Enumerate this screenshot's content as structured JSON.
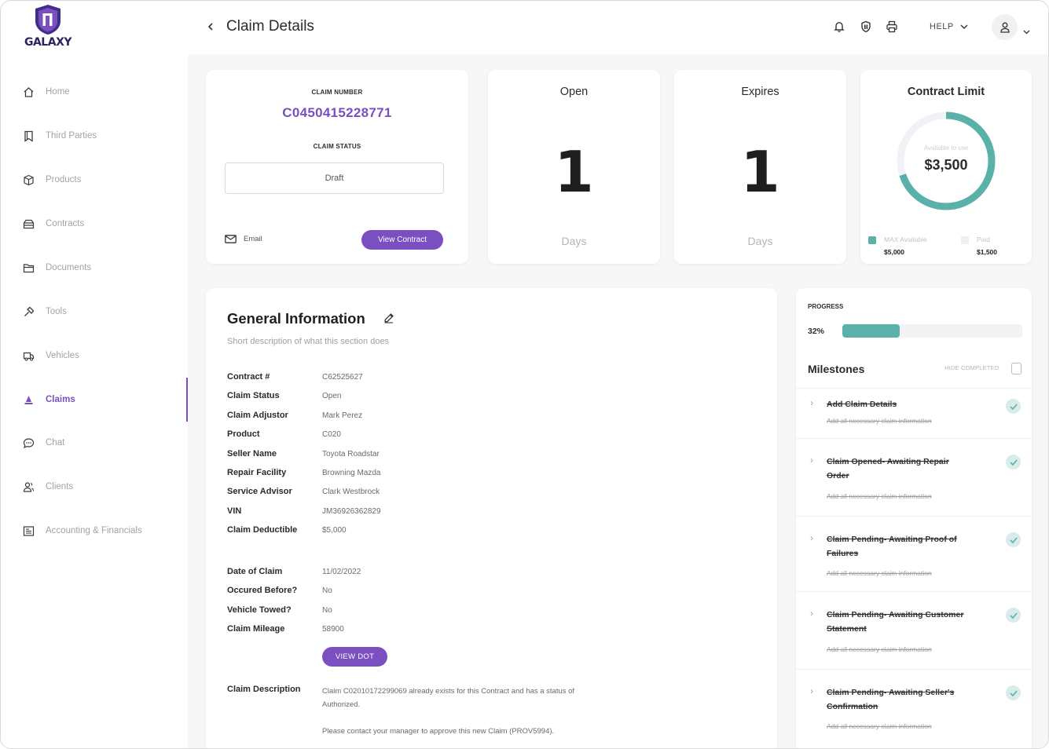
{
  "brand": {
    "name": "GALAXY",
    "accent": "#7a4fc0",
    "teal": "#5ab1a9"
  },
  "sidebar": {
    "items": [
      {
        "label": "Home",
        "icon": "home-icon"
      },
      {
        "label": "Third Parties",
        "icon": "bookmark-icon"
      },
      {
        "label": "Products",
        "icon": "box-icon"
      },
      {
        "label": "Contracts",
        "icon": "contract-icon"
      },
      {
        "label": "Documents",
        "icon": "folder-icon"
      },
      {
        "label": "Tools",
        "icon": "tools-icon"
      },
      {
        "label": "Vehicles",
        "icon": "truck-icon"
      },
      {
        "label": "Claims",
        "icon": "claims-icon",
        "active": true
      },
      {
        "label": "Chat",
        "icon": "chat-icon"
      },
      {
        "label": "Clients",
        "icon": "clients-icon"
      },
      {
        "label": "Accounting & Financials",
        "icon": "ledger-icon"
      }
    ]
  },
  "header": {
    "title": "Claim Details",
    "help_label": "HELP"
  },
  "claim": {
    "number_label": "CLAIM NUMBER",
    "number": "C0450415228771",
    "status_label": "CLAIM STATUS",
    "status": "Draft",
    "email_label": "Email",
    "view_contract_label": "View Contract"
  },
  "stats": {
    "open": {
      "title": "Open",
      "value": "1",
      "unit": "Days"
    },
    "expires": {
      "title": "Expires",
      "value": "1",
      "unit": "Days"
    }
  },
  "contract_limit": {
    "title": "Contract Limit",
    "center_label": "Available to use",
    "center_value": "$3,500",
    "available_fraction": 0.7,
    "legend": [
      {
        "label": "MAX Available",
        "value": "$5,000",
        "color": "#5ab1a9"
      },
      {
        "label": "Paid",
        "value": "$1,500",
        "color": "#eef0f3"
      }
    ]
  },
  "general_info": {
    "title": "General Information",
    "subtitle": "Short description of what this section does",
    "fields": [
      {
        "label": "Contract #",
        "value": "C62525627"
      },
      {
        "label": "Claim Status",
        "value": "Open"
      },
      {
        "label": "Claim Adjustor",
        "value": "Mark Perez"
      },
      {
        "label": "Product",
        "value": "C020"
      },
      {
        "label": "Seller Name",
        "value": "Toyota Roadstar"
      },
      {
        "label": "Repair Facility",
        "value": "Browning Mazda"
      },
      {
        "label": "Service Advisor",
        "value": "Clark Westbrock"
      },
      {
        "label": "VIN",
        "value": "JM36926362829"
      },
      {
        "label": "Claim Deductible",
        "value": "$5,000"
      }
    ],
    "fields2": [
      {
        "label": "Date of Claim",
        "value": "11/02/2022"
      },
      {
        "label": "Occured Before?",
        "value": "No"
      },
      {
        "label": "Vehicle Towed?",
        "value": "No"
      },
      {
        "label": "Claim Mileage",
        "value": "58900"
      }
    ],
    "view_dot_label": "VIEW DOT",
    "description_label": "Claim Description",
    "description_1": "Claim C02010172299069 already exists for this Contract and has a status of Authorized.",
    "description_2": "Please contact your manager to approve this new Claim (PROV5994)."
  },
  "progress": {
    "label": "PROGRESS",
    "percent_text": "32%",
    "value": 0.32
  },
  "milestones": {
    "title": "Milestones",
    "hide_completed_label": "HIDE COMPLETED",
    "items": [
      {
        "name": "Add Claim Details",
        "sub": "Add all necessary claim information"
      },
      {
        "name": "Claim Opened- Awaiting Repair Order",
        "sub": "Add all necessary claim information"
      },
      {
        "name": "Claim Pending- Awaiting Proof of Failures",
        "sub": "Add all necessary claim information"
      },
      {
        "name": "Claim Pending- Awaiting Customer Statement",
        "sub": "Add all necessary claim information"
      },
      {
        "name": "Claim Pending- Awaiting Seller's Confirmation",
        "sub": "Add all necessary claim information"
      }
    ]
  }
}
